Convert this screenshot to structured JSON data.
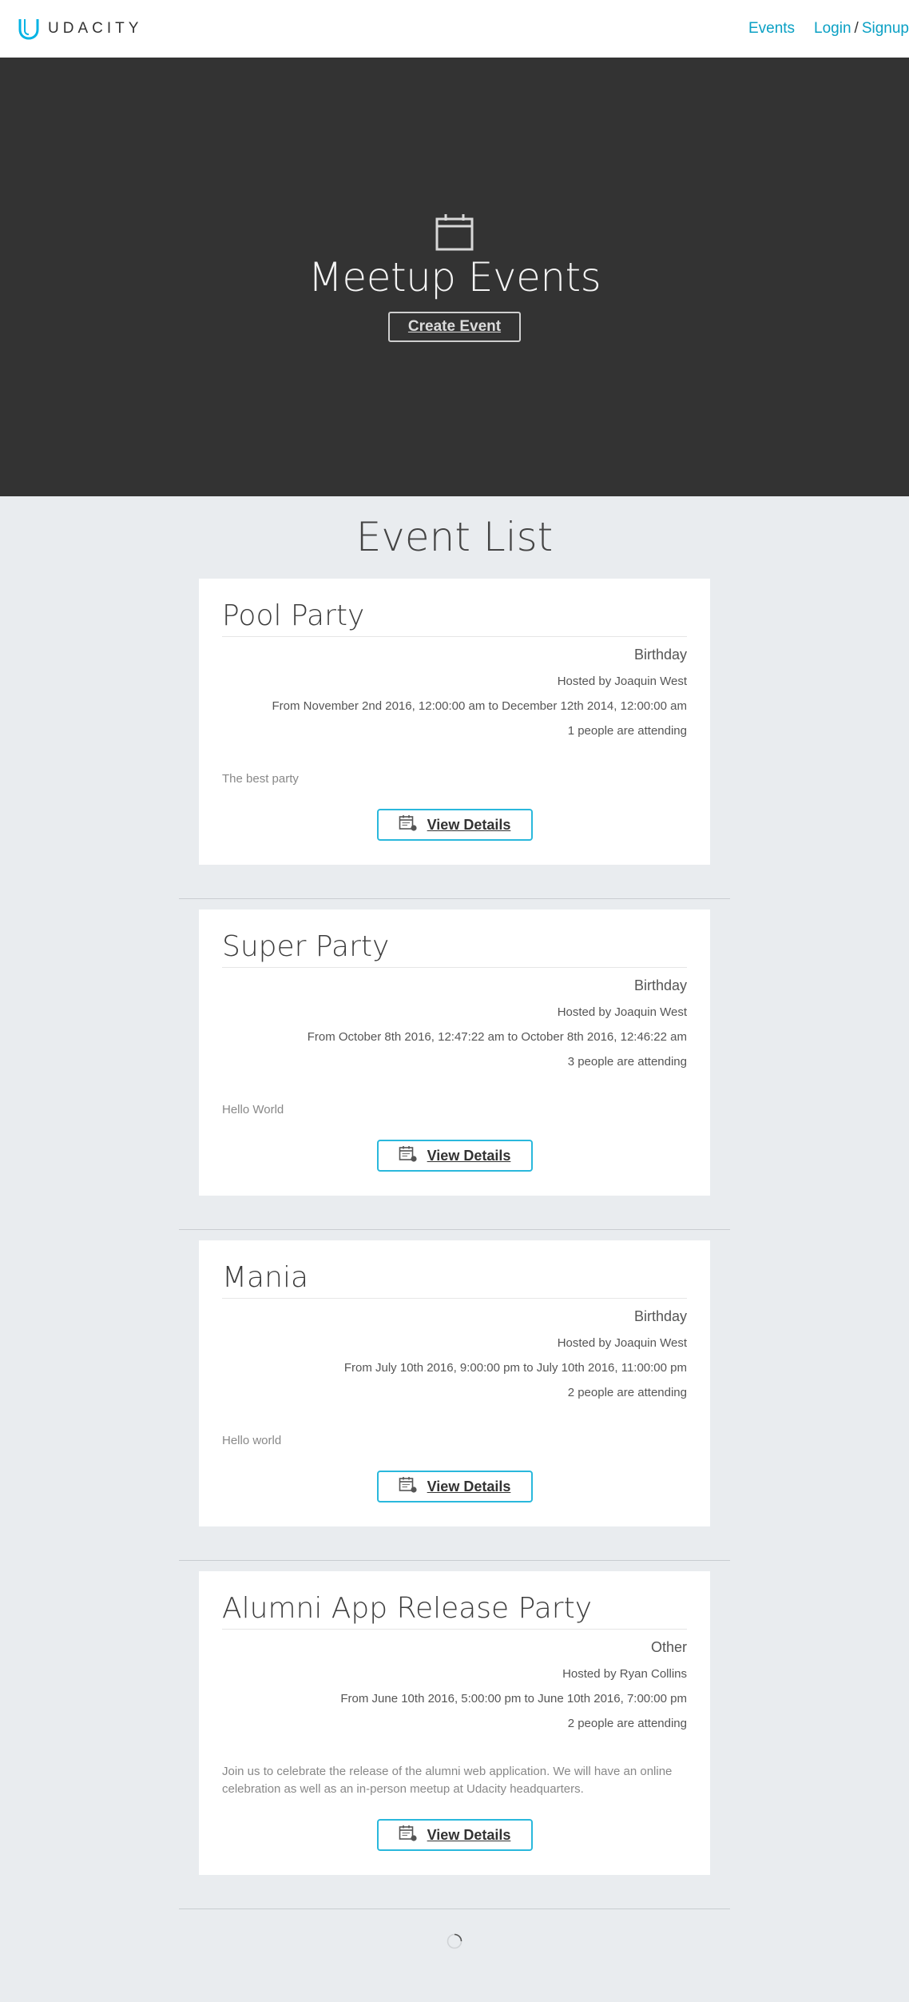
{
  "topbar": {
    "brand": "UDACITY",
    "logo_icon": "udacity-logo-icon",
    "nav": {
      "events": "Events",
      "login": "Login",
      "separator": "/",
      "signup": "Signup"
    }
  },
  "hero": {
    "icon": "calendar-icon",
    "title": "Meetup Events",
    "create_button": "Create Event"
  },
  "list": {
    "title": "Event List",
    "details_icon": "calendar-details-icon",
    "events": [
      {
        "title": "Pool Party",
        "type": "Birthday",
        "host": "Hosted by Joaquin West",
        "dates": "From November 2nd 2016, 12:00:00 am to December 12th 2014, 12:00:00 am",
        "attending": "1 people are attending",
        "description": "The best party",
        "button": "View Details"
      },
      {
        "title": "Super Party",
        "type": "Birthday",
        "host": "Hosted by Joaquin West",
        "dates": "From October 8th 2016, 12:47:22 am to October 8th 2016, 12:46:22 am",
        "attending": "3 people are attending",
        "description": "Hello World",
        "button": "View Details"
      },
      {
        "title": "Mania",
        "type": "Birthday",
        "host": "Hosted by Joaquin West",
        "dates": "From July 10th 2016, 9:00:00 pm to July 10th 2016, 11:00:00 pm",
        "attending": "2 people are attending",
        "description": "Hello world",
        "button": "View Details"
      },
      {
        "title": "Alumni App Release Party",
        "type": "Other",
        "host": "Hosted by Ryan Collins",
        "dates": "From June 10th 2016, 5:00:00 pm to June 10th 2016, 7:00:00 pm",
        "attending": "2 people are attending",
        "description": "Join us to celebrate the release of the alumni web application. We will have an online celebration as well as an in-person meetup at Udacity headquarters.",
        "button": "View Details"
      }
    ]
  },
  "loading": {
    "icon": "loading-spinner-icon"
  },
  "colors": {
    "accent": "#0aa0c4",
    "button_border": "#2ab8dc",
    "hero_bg": "#333333",
    "page_bg": "#e9ecef"
  }
}
